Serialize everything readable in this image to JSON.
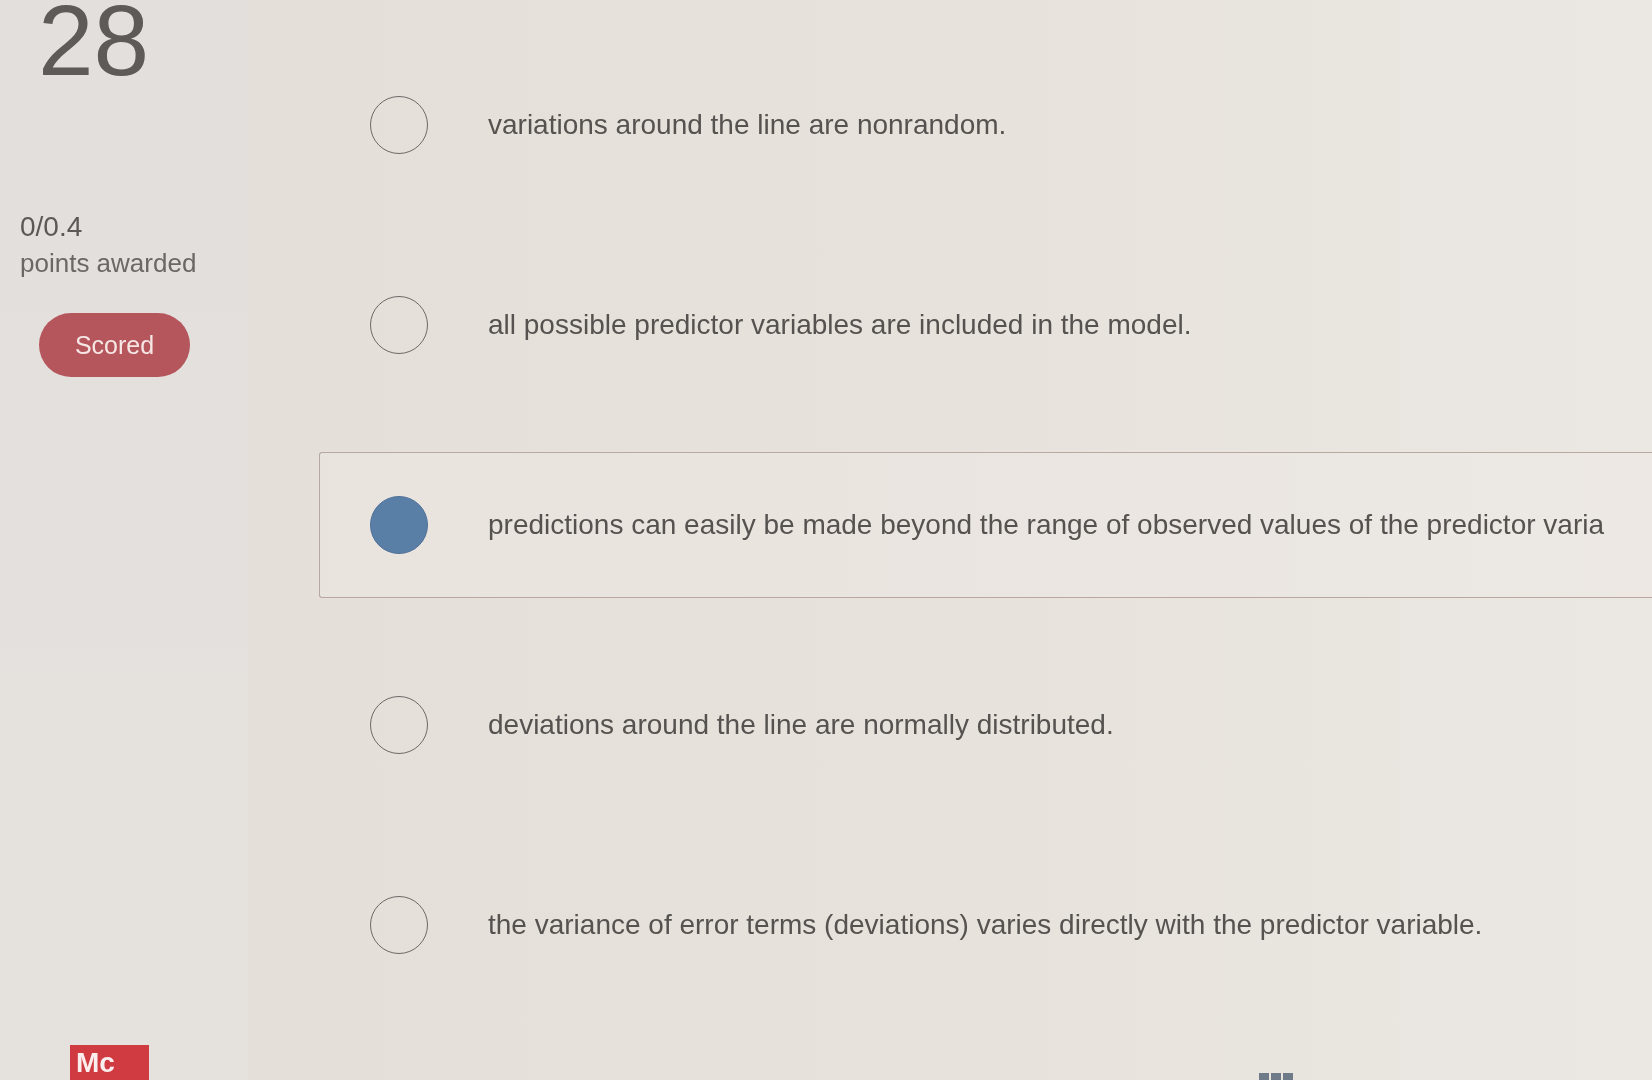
{
  "question": {
    "number": "28",
    "score": "0/0.4",
    "score_label": "points awarded",
    "status": "Scored"
  },
  "options": [
    {
      "text": "variations around the line are nonrandom.",
      "selected": false
    },
    {
      "text": "all possible predictor variables are included in the model.",
      "selected": false
    },
    {
      "text": "predictions can easily be made beyond the range of observed values of the predictor varia",
      "selected": true
    },
    {
      "text": "deviations around the line are normally distributed.",
      "selected": false
    },
    {
      "text": "the variance of error terms (deviations) varies directly with the predictor variable.",
      "selected": false
    }
  ],
  "logo": {
    "text": "Mc"
  }
}
